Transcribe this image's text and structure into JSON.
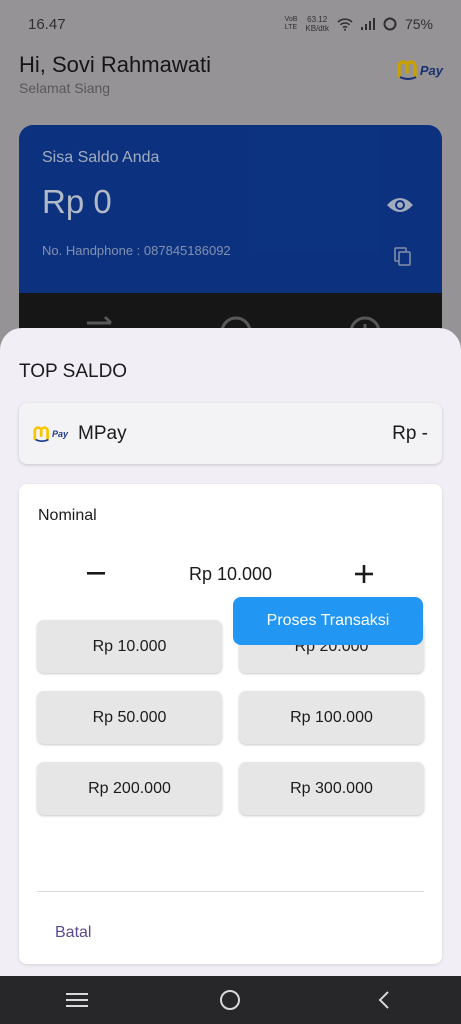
{
  "status_bar": {
    "time": "16.47",
    "network_top": "VoB",
    "network_bottom": "LTE",
    "speed_value": "63.12",
    "speed_unit": "KB/dtk",
    "battery": "75%"
  },
  "header": {
    "greeting": "Hi, Sovi Rahmawati",
    "subtitle": "Selamat Siang",
    "logo_text": "Pay"
  },
  "balance_card": {
    "label": "Sisa Saldo Anda",
    "balance": "Rp 0",
    "phone": "No. Handphone : 087845186092"
  },
  "sheet": {
    "title": "TOP SALDO",
    "wallet": {
      "logo_text": "Pay",
      "name": "MPay",
      "balance": "Rp -"
    },
    "nominal": {
      "label": "Nominal",
      "amount": "Rp 10.000",
      "options": [
        "Rp 10.000",
        "Rp 20.000",
        "Rp 50.000",
        "Rp 100.000",
        "Rp 200.000",
        "Rp 300.000"
      ]
    },
    "cancel_label": "Batal",
    "process_label": "Proses Transaksi"
  },
  "colors": {
    "card_blue": "#0f3e9b",
    "primary_button": "#2196f3",
    "cancel_text": "#5b4a8f",
    "logo_yellow": "#f7c600"
  },
  "icons": [
    "wifi-icon",
    "signal-icon",
    "battery-icon",
    "eye-icon",
    "copy-icon",
    "transfer-icon",
    "add-circle-icon",
    "minus-icon",
    "plus-icon",
    "menu-icon",
    "home-circle-icon",
    "back-icon"
  ]
}
